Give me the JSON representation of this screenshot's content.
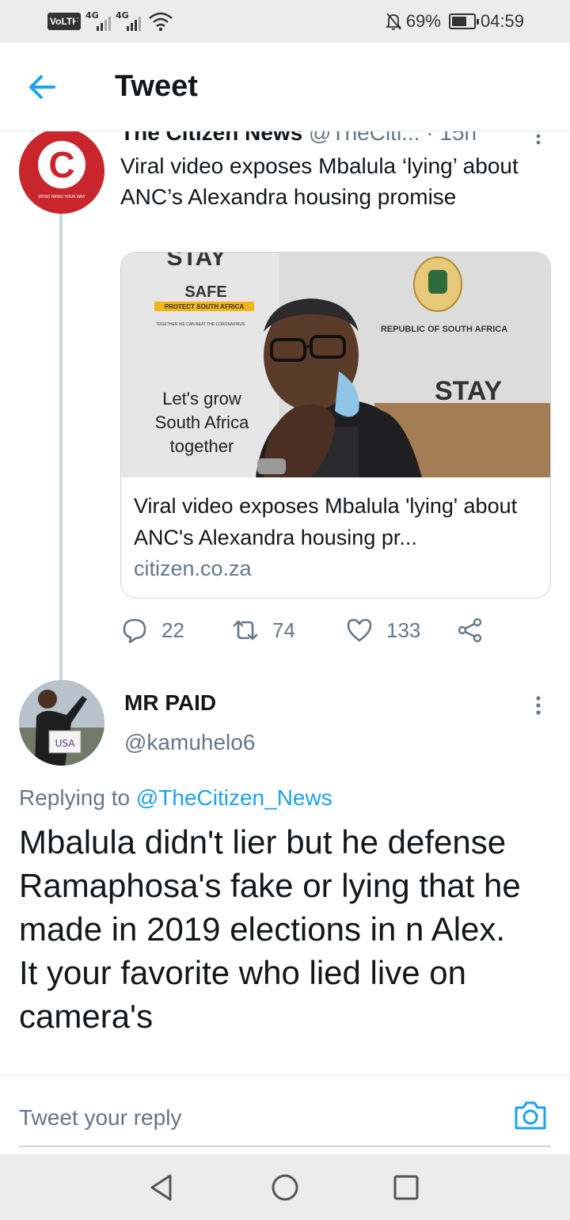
{
  "status_bar": {
    "volte": "VoLTE",
    "sim_number": "1",
    "network_1": "4G",
    "network_2": "4G",
    "battery": "69%",
    "time": "04:59",
    "icons": [
      "signal-icon",
      "wifi-icon",
      "mute-bell-icon",
      "battery-icon"
    ]
  },
  "header": {
    "back_icon": "arrow-left-icon",
    "title": "Tweet"
  },
  "tweet": {
    "author_name": "The Citizen News",
    "author_handle": "@TheCiti...",
    "time": "· 15h",
    "text": "Viral video exposes Mbalula ‘lying’ about ANC’s Alexandra housing promise",
    "avatar_letter": "C",
    "avatar_tagline": "MORE NEWS YOUR WAY",
    "card": {
      "image_texts": {
        "stay": "STAY",
        "safe": "SAFE",
        "protect": "PROTECT SOUTH AFRICA",
        "together_small": "TOGETHER WE CAN BEAT THE CORONAVIRUS",
        "republic": "REPUBLIC OF SOUTH AFRICA",
        "grow_1": "Let's grow",
        "grow_2": "South Africa",
        "grow_3": "together",
        "stay_right": "STAY"
      },
      "title": "Viral video exposes Mbalula 'lying' about ANC's Alexandra housing pr...",
      "domain": "citizen.co.za"
    },
    "actions": {
      "reply_count": "22",
      "retweet_count": "74",
      "like_count": "133"
    }
  },
  "reply": {
    "author_name": "MR PAID",
    "author_handle": "@kamuhelo6",
    "avatar_sign": "USA",
    "replying_prefix": "Replying to",
    "replying_to": "@TheCitizen_News",
    "text": "Mbalula didn't lier but he defense Ramaphosa's fake or lying that he made in 2019 elections in n Alex. It your favorite who lied live on camera's"
  },
  "composer": {
    "placeholder": "Tweet your reply",
    "camera_icon": "camera-icon"
  },
  "colors": {
    "accent": "#1da1f2",
    "text_primary": "#14171a",
    "text_secondary": "#657786",
    "citizen_red": "#c9252c",
    "border": "#ccd6dd"
  },
  "nav": {
    "icons": [
      "back-triangle-icon",
      "home-circle-icon",
      "recents-square-icon"
    ]
  }
}
